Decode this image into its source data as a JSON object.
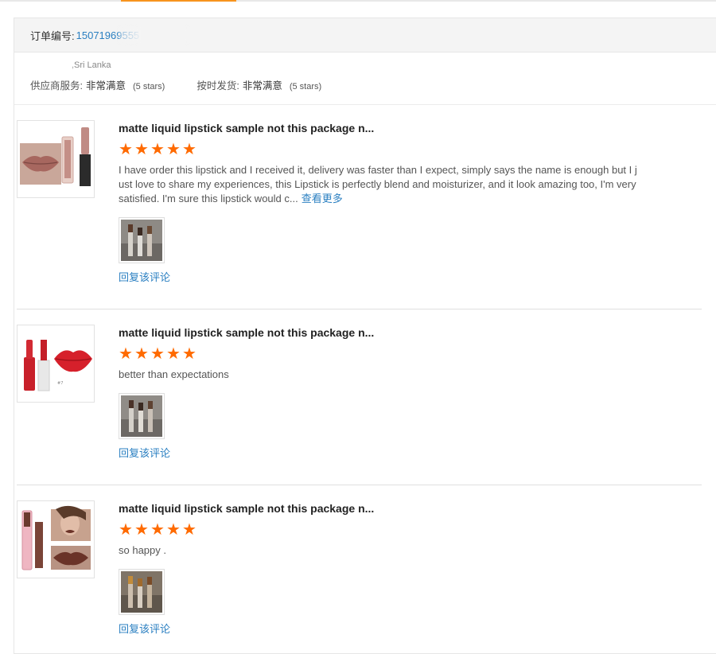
{
  "order": {
    "label": "订单编号:",
    "number_visible": "15071969555"
  },
  "summary": {
    "location_visible": ",Sri Lanka",
    "supplier_service": {
      "label": "供应商服务:",
      "value": "非常满意",
      "stars": "(5 stars)"
    },
    "on_time_delivery": {
      "label": "按时发货:",
      "value": "非常满意",
      "stars": "(5 stars)"
    }
  },
  "reviews": [
    {
      "title": "matte liquid lipstick sample not this package n...",
      "rating": 5,
      "text": "I have order this lipstick and I received it, delivery was faster than I expect, simply says the name is enough but I just love to share my experiences, this Lipstick is perfectly blend and moisturizer, and it look amazing too, I'm very satisfied. I'm sure this lipstick would c...",
      "more_label": "查看更多",
      "reply_label": "回复该评论",
      "product_icon": "nude-lipstick-product-image",
      "photo_icon": "customer-photo-thumbnail"
    },
    {
      "title": "matte liquid lipstick sample not this package n...",
      "rating": 5,
      "text": "better than expectations",
      "reply_label": "回复该评论",
      "product_icon": "red-lipstick-product-image",
      "photo_icon": "customer-photo-thumbnail"
    },
    {
      "title": "matte liquid lipstick sample not this package n...",
      "rating": 5,
      "text": "so happy .",
      "reply_label": "回复该评论",
      "product_icon": "brown-lipstick-product-image",
      "photo_icon": "customer-photo-thumbnail"
    }
  ],
  "colors": {
    "accent_orange": "#ff6a00",
    "link_blue": "#2a7fc1",
    "tab_underline": "#f7941e"
  }
}
